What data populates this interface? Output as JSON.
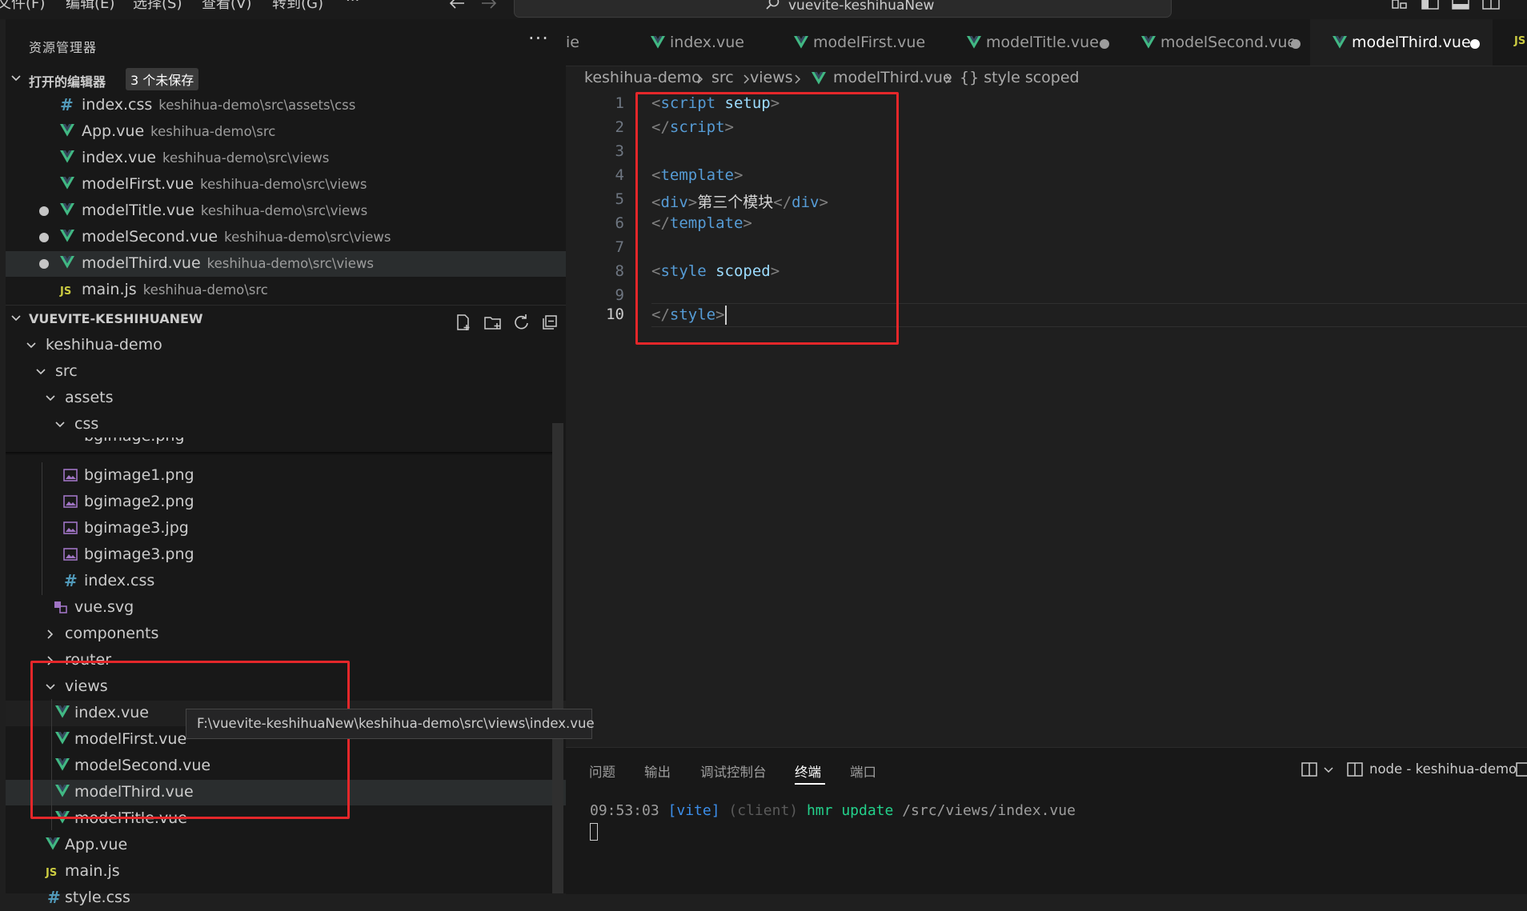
{
  "menu": {
    "items": [
      "文件(F)",
      "编辑(E)",
      "选择(S)",
      "查看(V)",
      "转到(G)",
      "···"
    ]
  },
  "command_center": {
    "text": "vuevite-keshihuaNew"
  },
  "sidebar": {
    "title": "资源管理器",
    "more": "···",
    "open_editors": {
      "label": "打开的编辑器",
      "badge": "3 个未保存",
      "items": [
        {
          "name": "index.css",
          "path": "keshihua-demo\\src\\assets\\css",
          "icon": "css-hash-icon",
          "modified": false
        },
        {
          "name": "App.vue",
          "path": "keshihua-demo\\src",
          "icon": "vue-icon",
          "modified": false
        },
        {
          "name": "index.vue",
          "path": "keshihua-demo\\src\\views",
          "icon": "vue-icon",
          "modified": false
        },
        {
          "name": "modelFirst.vue",
          "path": "keshihua-demo\\src\\views",
          "icon": "vue-icon",
          "modified": false
        },
        {
          "name": "modelTitle.vue",
          "path": "keshihua-demo\\src\\views",
          "icon": "vue-icon",
          "modified": true
        },
        {
          "name": "modelSecond.vue",
          "path": "keshihua-demo\\src\\views",
          "icon": "vue-icon",
          "modified": true
        },
        {
          "name": "modelThird.vue",
          "path": "keshihua-demo\\src\\views",
          "icon": "vue-icon",
          "modified": true
        },
        {
          "name": "main.js",
          "path": "keshihua-demo\\src",
          "icon": "js-icon",
          "modified": false
        }
      ]
    },
    "workspace": {
      "label": "VUEVITE-KESHIHUANEW",
      "tree": {
        "keshihua_demo": "keshihua-demo",
        "src": "src",
        "assets": "assets",
        "css": "css",
        "partial": "bgimage.png",
        "bgimage1": "bgimage1.png",
        "bgimage2": "bgimage2.png",
        "bgimage3jpg": "bgimage3.jpg",
        "bgimage3png": "bgimage3.png",
        "indexcss": "index.css",
        "vuesvg": "vue.svg",
        "components": "components",
        "router": "router",
        "views": "views",
        "views_items": [
          "index.vue",
          "modelFirst.vue",
          "modelSecond.vue",
          "modelThird.vue",
          "modelTitle.vue"
        ],
        "appvue": "App.vue",
        "mainjs": "main.js",
        "stylecss": "style.css"
      }
    }
  },
  "tabs": [
    {
      "label": "ie",
      "modified": false,
      "active": false
    },
    {
      "label": "index.vue",
      "modified": false,
      "active": false
    },
    {
      "label": "modelFirst.vue",
      "modified": false,
      "active": false
    },
    {
      "label": "modelTitle.vue",
      "modified": true,
      "active": false
    },
    {
      "label": "modelSecond.vue",
      "modified": true,
      "active": false
    },
    {
      "label": "modelThird.vue",
      "modified": true,
      "active": true
    },
    {
      "label": "JS",
      "modified": false,
      "active": false
    }
  ],
  "breadcrumb": [
    "keshihua-demo",
    "src",
    "views",
    "modelThird.vue",
    "{} style scoped"
  ],
  "editor": {
    "line_numbers": [
      "1",
      "2",
      "3",
      "4",
      "5",
      "6",
      "7",
      "8",
      "9",
      "10"
    ],
    "current_line": "10",
    "code": {
      "l1": {
        "open": "<",
        "tag": "script",
        "attr": "setup",
        "close": ">"
      },
      "l2": {
        "open": "</",
        "tag": "script",
        "close": ">"
      },
      "l4": {
        "open": "<",
        "tag": "template",
        "close": ">"
      },
      "l5": {
        "open": "<",
        "tag": "div",
        "close": ">",
        "text": "第三个模块",
        "end_open": "</",
        "end_tag": "div",
        "end_close": ">"
      },
      "l6": {
        "open": "</",
        "tag": "template",
        "close": ">"
      },
      "l8": {
        "open": "<",
        "tag": "style",
        "attr": "scoped",
        "close": ">"
      },
      "l10": {
        "open": "</",
        "tag": "style",
        "close": ">"
      }
    }
  },
  "tooltip": {
    "text": "F:\\vuevite-keshihuaNew\\keshihua-demo\\src\\views\\index.vue"
  },
  "panel": {
    "tabs": [
      "问题",
      "输出",
      "调试控制台",
      "终端",
      "端口"
    ],
    "active_tab": "终端",
    "terminal_name": "node - keshihua-demo",
    "terminal": {
      "time": "09:53:03",
      "vite": "[vite]",
      "client": "(client)",
      "hmr": "hmr update",
      "path": "/src/views/index.vue"
    }
  },
  "colors": {
    "annotation": "#e4272a",
    "vue": "#41b883",
    "accent": "#569cd6"
  }
}
